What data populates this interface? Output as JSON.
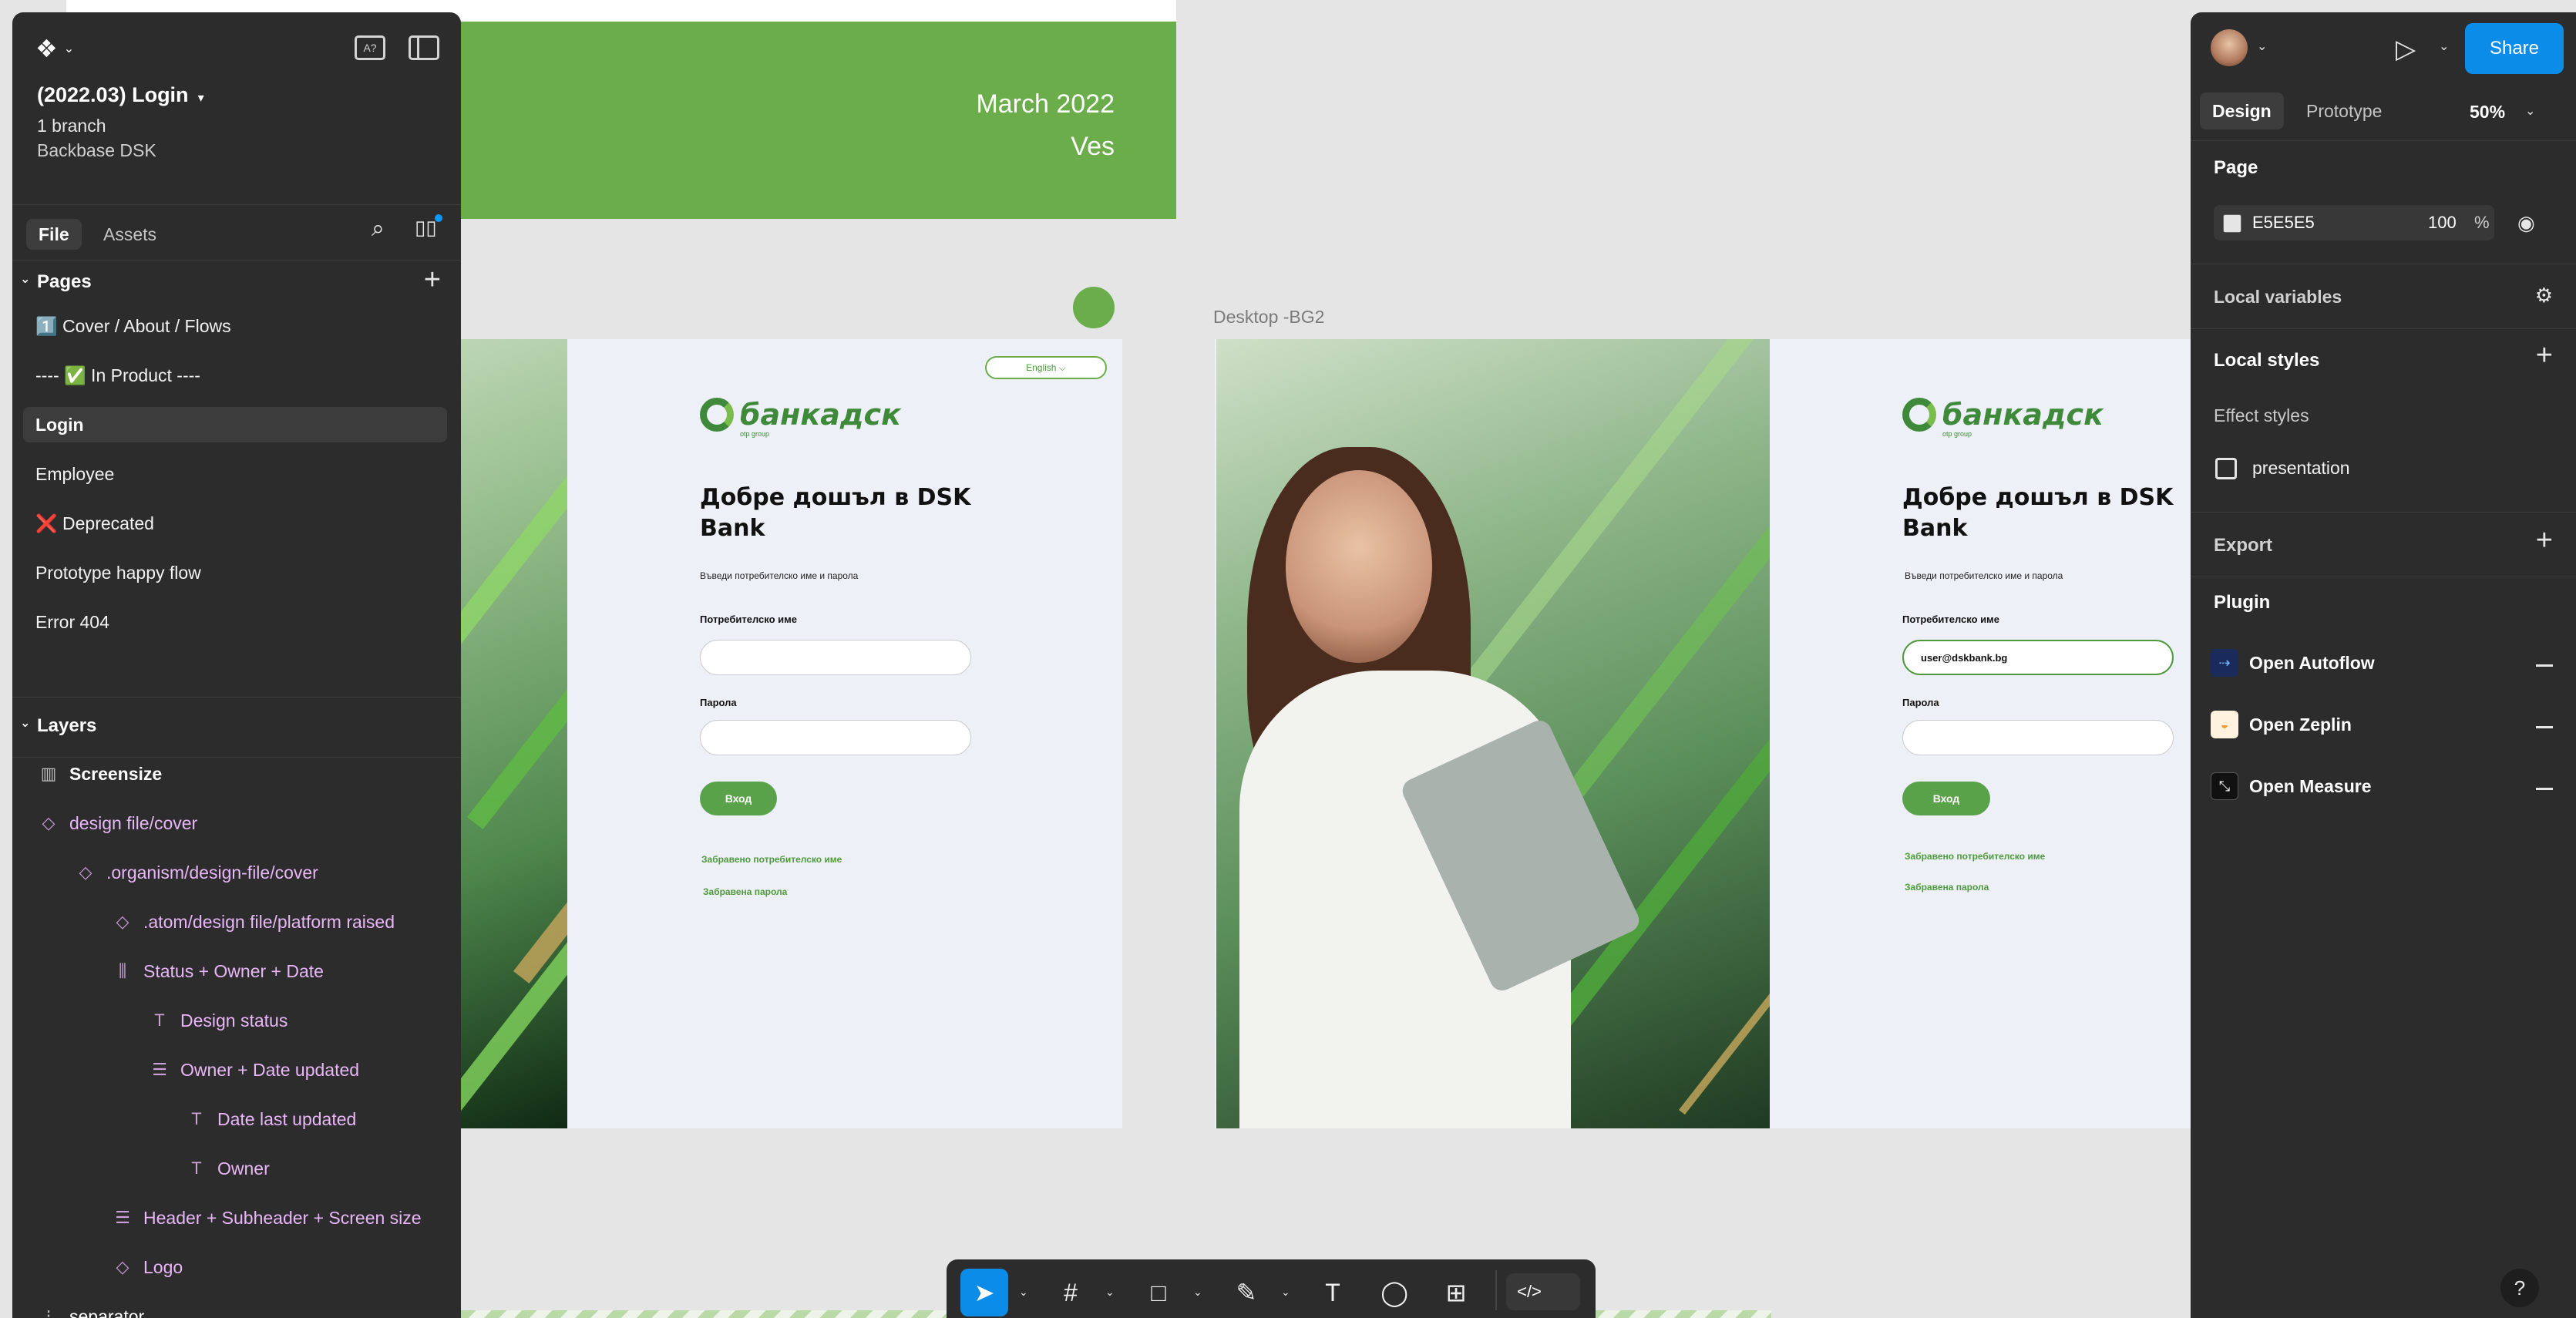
{
  "canvas": {
    "cover": {
      "date": "March 2022",
      "owner": "Ves"
    },
    "frame_label": "Desktop -BG2",
    "login_screen_1": {
      "language": "English ⌵",
      "bank_name": "банкадск",
      "bank_sub": "otp group",
      "welcome": "Добре дошъл в DSK Bank",
      "hint": "Въведи потребителско име и парола",
      "username_label": "Потребителско име",
      "username_value": "",
      "password_label": "Парола",
      "login_button": "Вход",
      "forgot_username": "Забравено потребителско име",
      "forgot_password": "Забравена парола"
    },
    "login_screen_2": {
      "bank_name": "банкадск",
      "bank_sub": "otp group",
      "welcome": "Добре дошъл в DSK Bank",
      "hint": "Въведи потребителско име и парола",
      "username_label": "Потребителско име",
      "username_value": "user@dskbank.bg",
      "password_label": "Парола",
      "login_button": "Вход",
      "forgot_username": "Забравено потребителско име",
      "forgot_password": "Забравена парола"
    }
  },
  "left_panel": {
    "file_title": "(2022.03) Login",
    "branches": "1 branch",
    "team": "Backbase DSK",
    "tabs": {
      "file": "File",
      "assets": "Assets"
    },
    "pages_label": "Pages",
    "pages": [
      "1️⃣ Cover / About / Flows",
      "---- ✅ In Product ----",
      "Login",
      "Employee",
      "❌ Deprecated",
      "Prototype happy flow",
      "Error 404"
    ],
    "layers_label": "Layers",
    "layers": [
      {
        "name": "Screensize",
        "icon": "columns-icon"
      },
      {
        "name": "design file/cover",
        "icon": "component-instance-icon"
      },
      {
        "name": ".organism/design-file/cover",
        "icon": "component-instance-icon"
      },
      {
        "name": ".atom/design file/platform raised",
        "icon": "component-instance-icon"
      },
      {
        "name": "Status + Owner + Date",
        "icon": "auto-layout-horizontal-icon"
      },
      {
        "name": "Design status",
        "icon": "text-icon"
      },
      {
        "name": "Owner + Date updated",
        "icon": "auto-layout-vertical-icon"
      },
      {
        "name": "Date last updated",
        "icon": "text-icon"
      },
      {
        "name": "Owner",
        "icon": "text-icon"
      },
      {
        "name": "Header + Subheader + Screen size",
        "icon": "auto-layout-vertical-icon"
      },
      {
        "name": "Logo",
        "icon": "component-instance-icon"
      },
      {
        "name": "separator",
        "icon": "grid-icon"
      }
    ]
  },
  "right_panel": {
    "share": "Share",
    "tabs": {
      "design": "Design",
      "prototype": "Prototype"
    },
    "zoom": "50%",
    "page_label": "Page",
    "page_color": "E5E5E5",
    "page_opacity": "100",
    "page_opacity_unit": "%",
    "local_variables": "Local variables",
    "local_styles": "Local styles",
    "effect_styles": "Effect styles",
    "effect_item": "presentation",
    "export": "Export",
    "plugin": "Plugin",
    "plugins": [
      "Open Autoflow",
      "Open Zeplin",
      "Open Measure"
    ]
  },
  "toolbar": {
    "tools": [
      "move-tool",
      "frame-tool",
      "shape-tool",
      "pen-tool",
      "text-tool",
      "comment-tool",
      "actions-tool"
    ],
    "dev_mode": "dev-mode-toggle"
  },
  "colors": {
    "accent": "#0C8CE9",
    "brand_green": "#6AAD4A",
    "panel_bg": "#2C2C2C",
    "canvas_bg": "#E5E5E5",
    "layer_purple": "#E9B6F9"
  }
}
